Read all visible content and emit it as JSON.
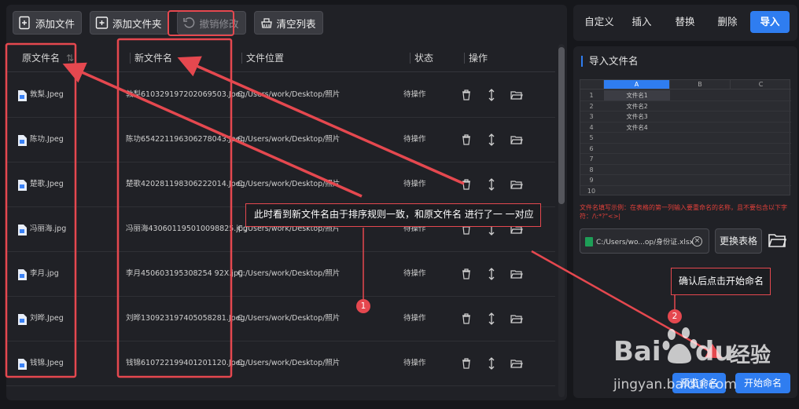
{
  "toolbar": {
    "add_file": "添加文件",
    "add_folder": "添加文件夹",
    "undo": "撤销修改",
    "clear": "清空列表"
  },
  "table": {
    "headers": {
      "original": "原文件名",
      "new": "新文件名",
      "location": "文件位置",
      "status": "状态",
      "actions": "操作"
    },
    "rows": [
      {
        "original": "敦梨.Jpeg",
        "new": "敦梨610329197202069503.Jpeg",
        "location": "C:/Users/work/Desktop/照片",
        "status": "待操作"
      },
      {
        "original": "陈功.Jpeg",
        "new": "陈功654221196306278043.Jpeg",
        "location": "C:/Users/work/Desktop/照片",
        "status": "待操作"
      },
      {
        "original": "楚歌.Jpeg",
        "new": "楚歌420281198306222014.Jpeg",
        "location": "C:/Users/work/Desktop/照片",
        "status": "待操作"
      },
      {
        "original": "冯丽海.jpg",
        "new": "冯丽海430601195010098825.jpg",
        "location": "C:/Users/work/Desktop/照片",
        "status": "待操作"
      },
      {
        "original": "李月.jpg",
        "new": "李月450603195308254 92X.jpg",
        "location": "C:/Users/work/Desktop/照片",
        "status": "待操作"
      },
      {
        "original": "刘晔.Jpeg",
        "new": "刘晔130923197405058281.Jpeg",
        "location": "C:/Users/work/Desktop/照片",
        "status": "待操作"
      },
      {
        "original": "钱锦.Jpeg",
        "new": "钱锦610722199401201120.Jpeg",
        "location": "C:/Users/work/Desktop/照片",
        "status": "待操作"
      }
    ]
  },
  "right_tabs": {
    "custom": "自定义",
    "insert": "插入",
    "replace": "替换",
    "delete": "删除",
    "import": "导入"
  },
  "import_panel": {
    "title": "导入文件名",
    "sheet_cols": [
      "A",
      "B",
      "C"
    ],
    "sheet_rows": [
      "1",
      "2",
      "3",
      "4",
      "5",
      "6",
      "7",
      "8",
      "9",
      "10"
    ],
    "sheet_values": [
      "文件名1",
      "文件名2",
      "文件名3",
      "文件名4"
    ],
    "hint": "文件名填写示例：在表格的第一列输入要重命名的名称，且不要包含以下字符：/\\:*?\"<>|",
    "file_path": "C:/Users/wo...op/身份证.xlsx",
    "swap_button": "更换表格",
    "preview_button": "预览命名",
    "start_button": "开始命名"
  },
  "annotations": {
    "callout1": "此时看到新文件名由于排序规则一致，和原文件名 进行了一 一对应",
    "callout2": "确认后点击开始命名",
    "badge1": "1",
    "badge2": "2"
  },
  "watermark": {
    "brand": "Bai",
    "brand2": "du",
    "cn": "经验",
    "url": "jingyan.baidu.com"
  },
  "colors": {
    "accent": "#2f7df0",
    "annotation": "#e5484f",
    "hint": "#e0403a"
  }
}
